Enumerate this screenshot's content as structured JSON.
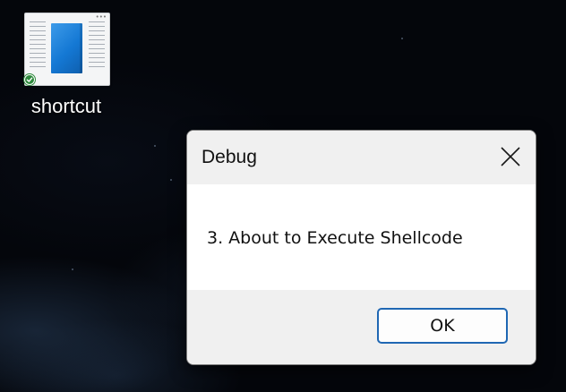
{
  "desktop": {
    "shortcut": {
      "label": "shortcut",
      "icon": "document-file-icon",
      "status_icon": "sync-check-icon"
    }
  },
  "dialog": {
    "title": "Debug",
    "message": "3. About to Execute Shellcode",
    "ok_label": "OK",
    "close_icon": "close-icon"
  },
  "colors": {
    "dialog_titlebar_bg": "#f0f0f0",
    "dialog_footer_bg": "#f0f0f0",
    "ok_button_border": "#1f67b3",
    "doc_icon_blue": "#1478d4",
    "check_green": "#2f8a3e"
  }
}
